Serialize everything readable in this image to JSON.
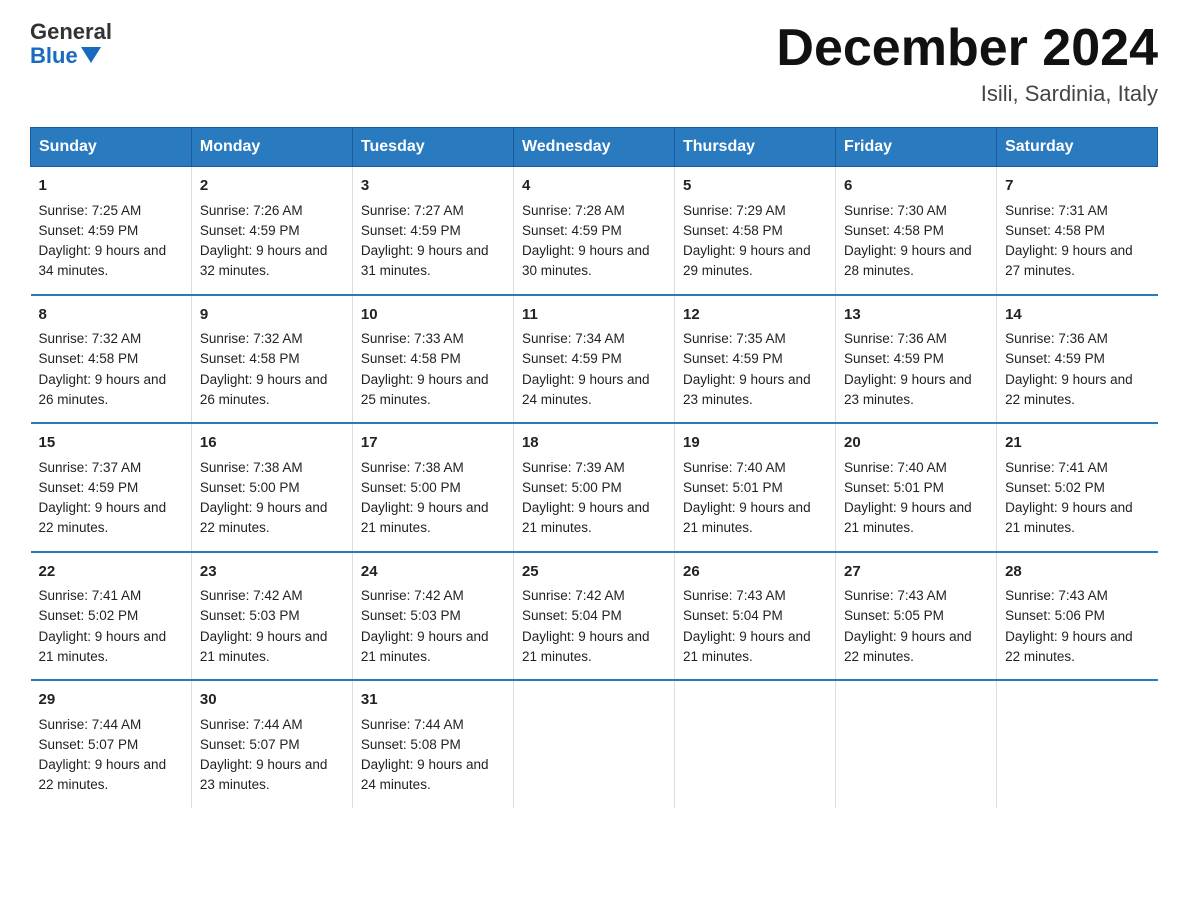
{
  "header": {
    "logo_general": "General",
    "logo_blue": "Blue",
    "month_title": "December 2024",
    "location": "Isili, Sardinia, Italy"
  },
  "days_of_week": [
    "Sunday",
    "Monday",
    "Tuesday",
    "Wednesday",
    "Thursday",
    "Friday",
    "Saturday"
  ],
  "weeks": [
    [
      {
        "day": "1",
        "sunrise": "7:25 AM",
        "sunset": "4:59 PM",
        "daylight": "9 hours and 34 minutes."
      },
      {
        "day": "2",
        "sunrise": "7:26 AM",
        "sunset": "4:59 PM",
        "daylight": "9 hours and 32 minutes."
      },
      {
        "day": "3",
        "sunrise": "7:27 AM",
        "sunset": "4:59 PM",
        "daylight": "9 hours and 31 minutes."
      },
      {
        "day": "4",
        "sunrise": "7:28 AM",
        "sunset": "4:59 PM",
        "daylight": "9 hours and 30 minutes."
      },
      {
        "day": "5",
        "sunrise": "7:29 AM",
        "sunset": "4:58 PM",
        "daylight": "9 hours and 29 minutes."
      },
      {
        "day": "6",
        "sunrise": "7:30 AM",
        "sunset": "4:58 PM",
        "daylight": "9 hours and 28 minutes."
      },
      {
        "day": "7",
        "sunrise": "7:31 AM",
        "sunset": "4:58 PM",
        "daylight": "9 hours and 27 minutes."
      }
    ],
    [
      {
        "day": "8",
        "sunrise": "7:32 AM",
        "sunset": "4:58 PM",
        "daylight": "9 hours and 26 minutes."
      },
      {
        "day": "9",
        "sunrise": "7:32 AM",
        "sunset": "4:58 PM",
        "daylight": "9 hours and 26 minutes."
      },
      {
        "day": "10",
        "sunrise": "7:33 AM",
        "sunset": "4:58 PM",
        "daylight": "9 hours and 25 minutes."
      },
      {
        "day": "11",
        "sunrise": "7:34 AM",
        "sunset": "4:59 PM",
        "daylight": "9 hours and 24 minutes."
      },
      {
        "day": "12",
        "sunrise": "7:35 AM",
        "sunset": "4:59 PM",
        "daylight": "9 hours and 23 minutes."
      },
      {
        "day": "13",
        "sunrise": "7:36 AM",
        "sunset": "4:59 PM",
        "daylight": "9 hours and 23 minutes."
      },
      {
        "day": "14",
        "sunrise": "7:36 AM",
        "sunset": "4:59 PM",
        "daylight": "9 hours and 22 minutes."
      }
    ],
    [
      {
        "day": "15",
        "sunrise": "7:37 AM",
        "sunset": "4:59 PM",
        "daylight": "9 hours and 22 minutes."
      },
      {
        "day": "16",
        "sunrise": "7:38 AM",
        "sunset": "5:00 PM",
        "daylight": "9 hours and 22 minutes."
      },
      {
        "day": "17",
        "sunrise": "7:38 AM",
        "sunset": "5:00 PM",
        "daylight": "9 hours and 21 minutes."
      },
      {
        "day": "18",
        "sunrise": "7:39 AM",
        "sunset": "5:00 PM",
        "daylight": "9 hours and 21 minutes."
      },
      {
        "day": "19",
        "sunrise": "7:40 AM",
        "sunset": "5:01 PM",
        "daylight": "9 hours and 21 minutes."
      },
      {
        "day": "20",
        "sunrise": "7:40 AM",
        "sunset": "5:01 PM",
        "daylight": "9 hours and 21 minutes."
      },
      {
        "day": "21",
        "sunrise": "7:41 AM",
        "sunset": "5:02 PM",
        "daylight": "9 hours and 21 minutes."
      }
    ],
    [
      {
        "day": "22",
        "sunrise": "7:41 AM",
        "sunset": "5:02 PM",
        "daylight": "9 hours and 21 minutes."
      },
      {
        "day": "23",
        "sunrise": "7:42 AM",
        "sunset": "5:03 PM",
        "daylight": "9 hours and 21 minutes."
      },
      {
        "day": "24",
        "sunrise": "7:42 AM",
        "sunset": "5:03 PM",
        "daylight": "9 hours and 21 minutes."
      },
      {
        "day": "25",
        "sunrise": "7:42 AM",
        "sunset": "5:04 PM",
        "daylight": "9 hours and 21 minutes."
      },
      {
        "day": "26",
        "sunrise": "7:43 AM",
        "sunset": "5:04 PM",
        "daylight": "9 hours and 21 minutes."
      },
      {
        "day": "27",
        "sunrise": "7:43 AM",
        "sunset": "5:05 PM",
        "daylight": "9 hours and 22 minutes."
      },
      {
        "day": "28",
        "sunrise": "7:43 AM",
        "sunset": "5:06 PM",
        "daylight": "9 hours and 22 minutes."
      }
    ],
    [
      {
        "day": "29",
        "sunrise": "7:44 AM",
        "sunset": "5:07 PM",
        "daylight": "9 hours and 22 minutes."
      },
      {
        "day": "30",
        "sunrise": "7:44 AM",
        "sunset": "5:07 PM",
        "daylight": "9 hours and 23 minutes."
      },
      {
        "day": "31",
        "sunrise": "7:44 AM",
        "sunset": "5:08 PM",
        "daylight": "9 hours and 24 minutes."
      },
      null,
      null,
      null,
      null
    ]
  ],
  "cell_labels": {
    "sunrise": "Sunrise:",
    "sunset": "Sunset:",
    "daylight": "Daylight:"
  }
}
